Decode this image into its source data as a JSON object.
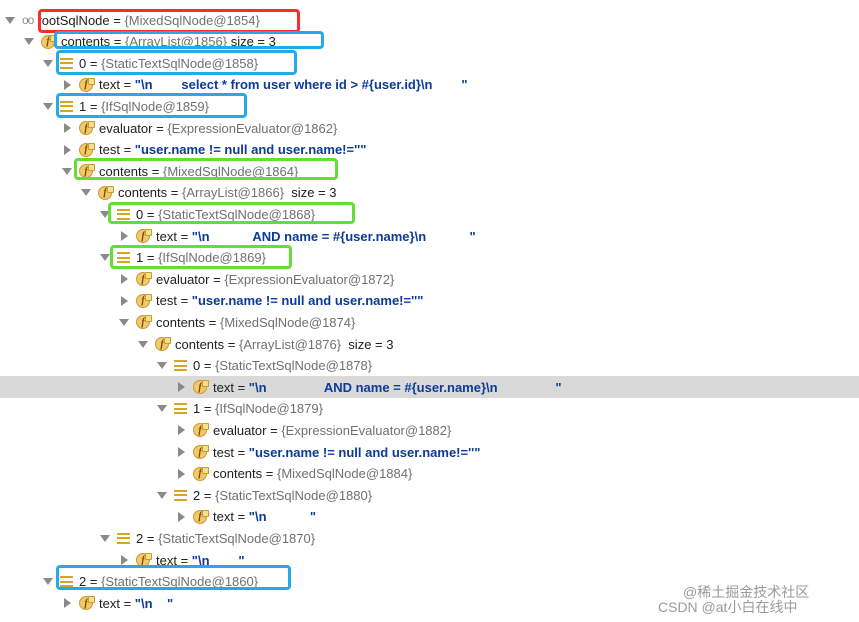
{
  "tree": [
    {
      "indent": 0,
      "icon": "oo",
      "expanded": true,
      "name": "rootSqlNode",
      "ref": "{MixedSqlNode@1854}"
    },
    {
      "indent": 1,
      "icon": "field",
      "expanded": true,
      "name": "contents",
      "ref": "{ArrayList@1856}",
      "size": " size = 3"
    },
    {
      "indent": 2,
      "icon": "array",
      "expanded": true,
      "name": "0",
      "ref": "{StaticTextSqlNode@1858}"
    },
    {
      "indent": 3,
      "icon": "field",
      "expanded": false,
      "name": "text",
      "str": "\"\\n        select * from user where id > #{user.id}\\n        \""
    },
    {
      "indent": 2,
      "icon": "array",
      "expanded": true,
      "name": "1",
      "ref": "{IfSqlNode@1859}"
    },
    {
      "indent": 3,
      "icon": "field",
      "expanded": false,
      "name": "evaluator",
      "ref": "{ExpressionEvaluator@1862}"
    },
    {
      "indent": 3,
      "icon": "field",
      "expanded": false,
      "name": "test",
      "str": "\"user.name != null and user.name!=''\""
    },
    {
      "indent": 3,
      "icon": "field",
      "expanded": true,
      "name": "contents",
      "ref": "{MixedSqlNode@1864}"
    },
    {
      "indent": 4,
      "icon": "field",
      "expanded": true,
      "name": "contents",
      "ref": "{ArrayList@1866}",
      "size": "  size = 3"
    },
    {
      "indent": 5,
      "icon": "array",
      "expanded": true,
      "name": "0",
      "ref": "{StaticTextSqlNode@1868}"
    },
    {
      "indent": 6,
      "icon": "field",
      "expanded": false,
      "name": "text",
      "str": "\"\\n            AND name = #{user.name}\\n            \""
    },
    {
      "indent": 5,
      "icon": "array",
      "expanded": true,
      "name": "1",
      "ref": "{IfSqlNode@1869}"
    },
    {
      "indent": 6,
      "icon": "field",
      "expanded": false,
      "name": "evaluator",
      "ref": "{ExpressionEvaluator@1872}"
    },
    {
      "indent": 6,
      "icon": "field",
      "expanded": false,
      "name": "test",
      "str": "\"user.name != null and user.name!=''\""
    },
    {
      "indent": 6,
      "icon": "field",
      "expanded": true,
      "name": "contents",
      "ref": "{MixedSqlNode@1874}"
    },
    {
      "indent": 7,
      "icon": "field",
      "expanded": true,
      "name": "contents",
      "ref": "{ArrayList@1876}",
      "size": "  size = 3"
    },
    {
      "indent": 8,
      "icon": "array",
      "expanded": true,
      "name": "0",
      "ref": "{StaticTextSqlNode@1878}"
    },
    {
      "indent": 9,
      "icon": "field",
      "expanded": false,
      "name": "text",
      "str": "\"\\n                AND name = #{user.name}\\n                \"",
      "selected": true
    },
    {
      "indent": 8,
      "icon": "array",
      "expanded": true,
      "name": "1",
      "ref": "{IfSqlNode@1879}"
    },
    {
      "indent": 9,
      "icon": "field",
      "expanded": false,
      "name": "evaluator",
      "ref": "{ExpressionEvaluator@1882}"
    },
    {
      "indent": 9,
      "icon": "field",
      "expanded": false,
      "name": "test",
      "str": "\"user.name != null and user.name!=''\""
    },
    {
      "indent": 9,
      "icon": "field",
      "expanded": false,
      "name": "contents",
      "ref": "{MixedSqlNode@1884}"
    },
    {
      "indent": 8,
      "icon": "array",
      "expanded": true,
      "name": "2",
      "ref": "{StaticTextSqlNode@1880}"
    },
    {
      "indent": 9,
      "icon": "field",
      "expanded": false,
      "name": "text",
      "str": "\"\\n            \""
    },
    {
      "indent": 5,
      "icon": "array",
      "expanded": true,
      "name": "2",
      "ref": "{StaticTextSqlNode@1870}"
    },
    {
      "indent": 6,
      "icon": "field",
      "expanded": false,
      "name": "text",
      "str": "\"\\n        \""
    },
    {
      "indent": 2,
      "icon": "array",
      "expanded": true,
      "name": "2",
      "ref": "{StaticTextSqlNode@1860}"
    },
    {
      "indent": 3,
      "icon": "field",
      "expanded": false,
      "name": "text",
      "str": "\"\\n    \""
    }
  ],
  "watermark": {
    "line1": "@稀土掘金技术社区",
    "line2": "CSDN @at小白在线中"
  },
  "colors": {
    "red_box": "#ff2a2a",
    "blue_box": "#26a9e8",
    "green_box": "#66dd33",
    "selected_row": "#d9d9d9",
    "string_value": "#0b3a9a"
  }
}
